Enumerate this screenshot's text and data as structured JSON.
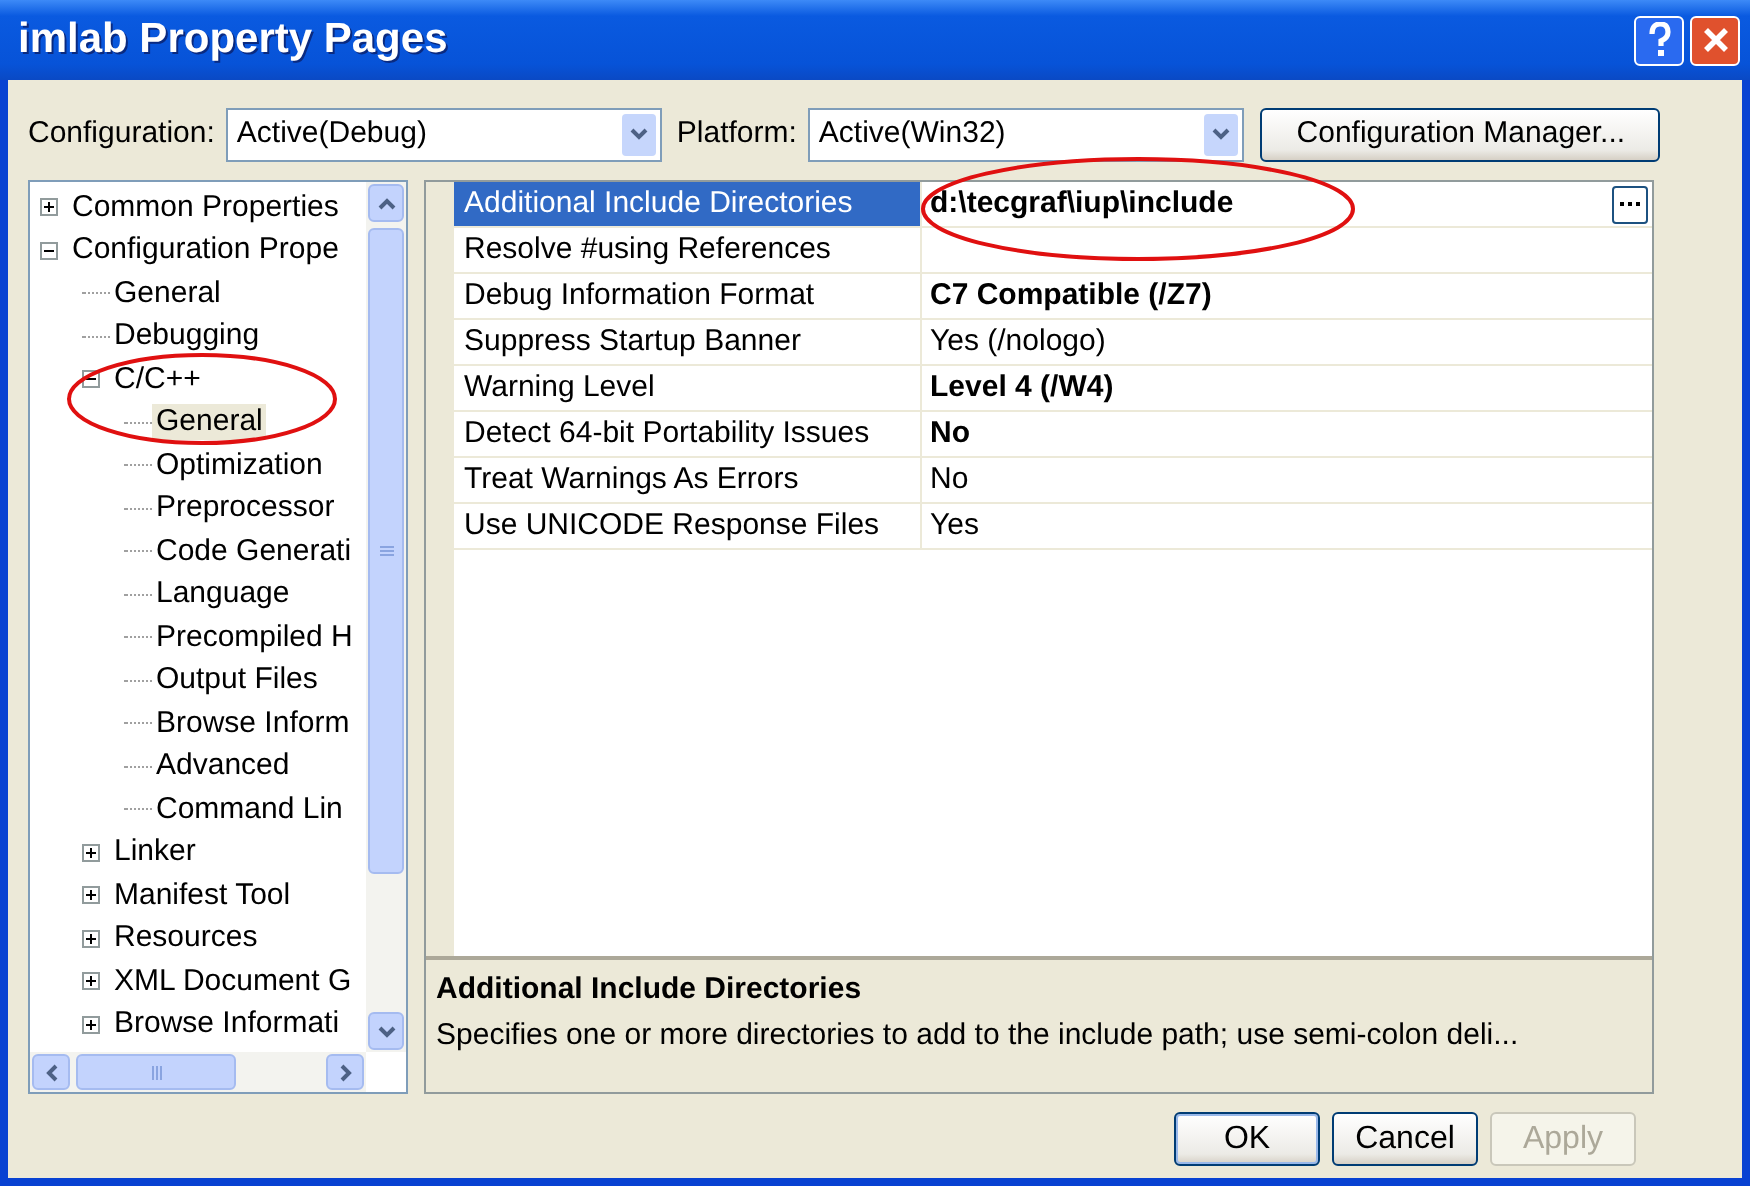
{
  "window": {
    "title": "imlab Property Pages"
  },
  "toolbar": {
    "configuration": {
      "label": "Configuration:",
      "value": "Active(Debug)"
    },
    "platform": {
      "label": "Platform:",
      "value": "Active(Win32)"
    },
    "manager_button": "Configuration Manager..."
  },
  "tree": [
    {
      "label": "Common Properties",
      "expanded": false,
      "selected": false
    },
    {
      "label": "Configuration Prope",
      "expanded": true,
      "selected": false,
      "children": [
        {
          "label": "General",
          "selected": false
        },
        {
          "label": "Debugging",
          "selected": false
        },
        {
          "label": "C/C++",
          "expanded": true,
          "selected": false,
          "children": [
            {
              "label": "General",
              "selected": true
            },
            {
              "label": "Optimization",
              "selected": false
            },
            {
              "label": "Preprocessor",
              "selected": false
            },
            {
              "label": "Code Generati",
              "selected": false
            },
            {
              "label": "Language",
              "selected": false
            },
            {
              "label": "Precompiled H",
              "selected": false
            },
            {
              "label": "Output Files",
              "selected": false
            },
            {
              "label": "Browse Inform",
              "selected": false
            },
            {
              "label": "Advanced",
              "selected": false
            },
            {
              "label": "Command Lin",
              "selected": false
            }
          ]
        },
        {
          "label": "Linker",
          "expanded": false,
          "selected": false
        },
        {
          "label": "Manifest Tool",
          "expanded": false,
          "selected": false
        },
        {
          "label": "Resources",
          "expanded": false,
          "selected": false
        },
        {
          "label": "XML Document G",
          "expanded": false,
          "selected": false
        },
        {
          "label": "Browse Informati",
          "expanded": false,
          "selected": false
        }
      ]
    }
  ],
  "properties": [
    {
      "name": "Additional Include Directories",
      "value": "d:\\tecgraf\\iup\\include",
      "bold": true,
      "selected": true,
      "browse": true
    },
    {
      "name": "Resolve #using References",
      "selected": false,
      "browse": false
    },
    {
      "name": "Debug Information Format",
      "value": "C7 Compatible (/Z7)",
      "bold": true,
      "selected": false,
      "browse": false
    },
    {
      "name": "Suppress Startup Banner",
      "value": "Yes (/nologo)",
      "bold": false,
      "selected": false,
      "browse": false
    },
    {
      "name": "Warning Level",
      "value": "Level 4 (/W4)",
      "bold": true,
      "selected": false,
      "browse": false
    },
    {
      "name": "Detect 64-bit Portability Issues",
      "value": "No",
      "bold": true,
      "selected": false,
      "browse": false
    },
    {
      "name": "Treat Warnings As Errors",
      "value": "No",
      "bold": false,
      "selected": false,
      "browse": false
    },
    {
      "name": "Use UNICODE Response Files",
      "value": "Yes",
      "bold": false,
      "selected": false,
      "browse": false
    }
  ],
  "description": {
    "title": "Additional Include Directories",
    "text": "Specifies one or more directories to add to the include path; use semi-colon deli..."
  },
  "buttons": [
    {
      "label": "OK",
      "disabled": false,
      "default": true
    },
    {
      "label": "Cancel",
      "disabled": false,
      "default": false
    },
    {
      "label": "Apply",
      "disabled": true,
      "default": false
    }
  ]
}
